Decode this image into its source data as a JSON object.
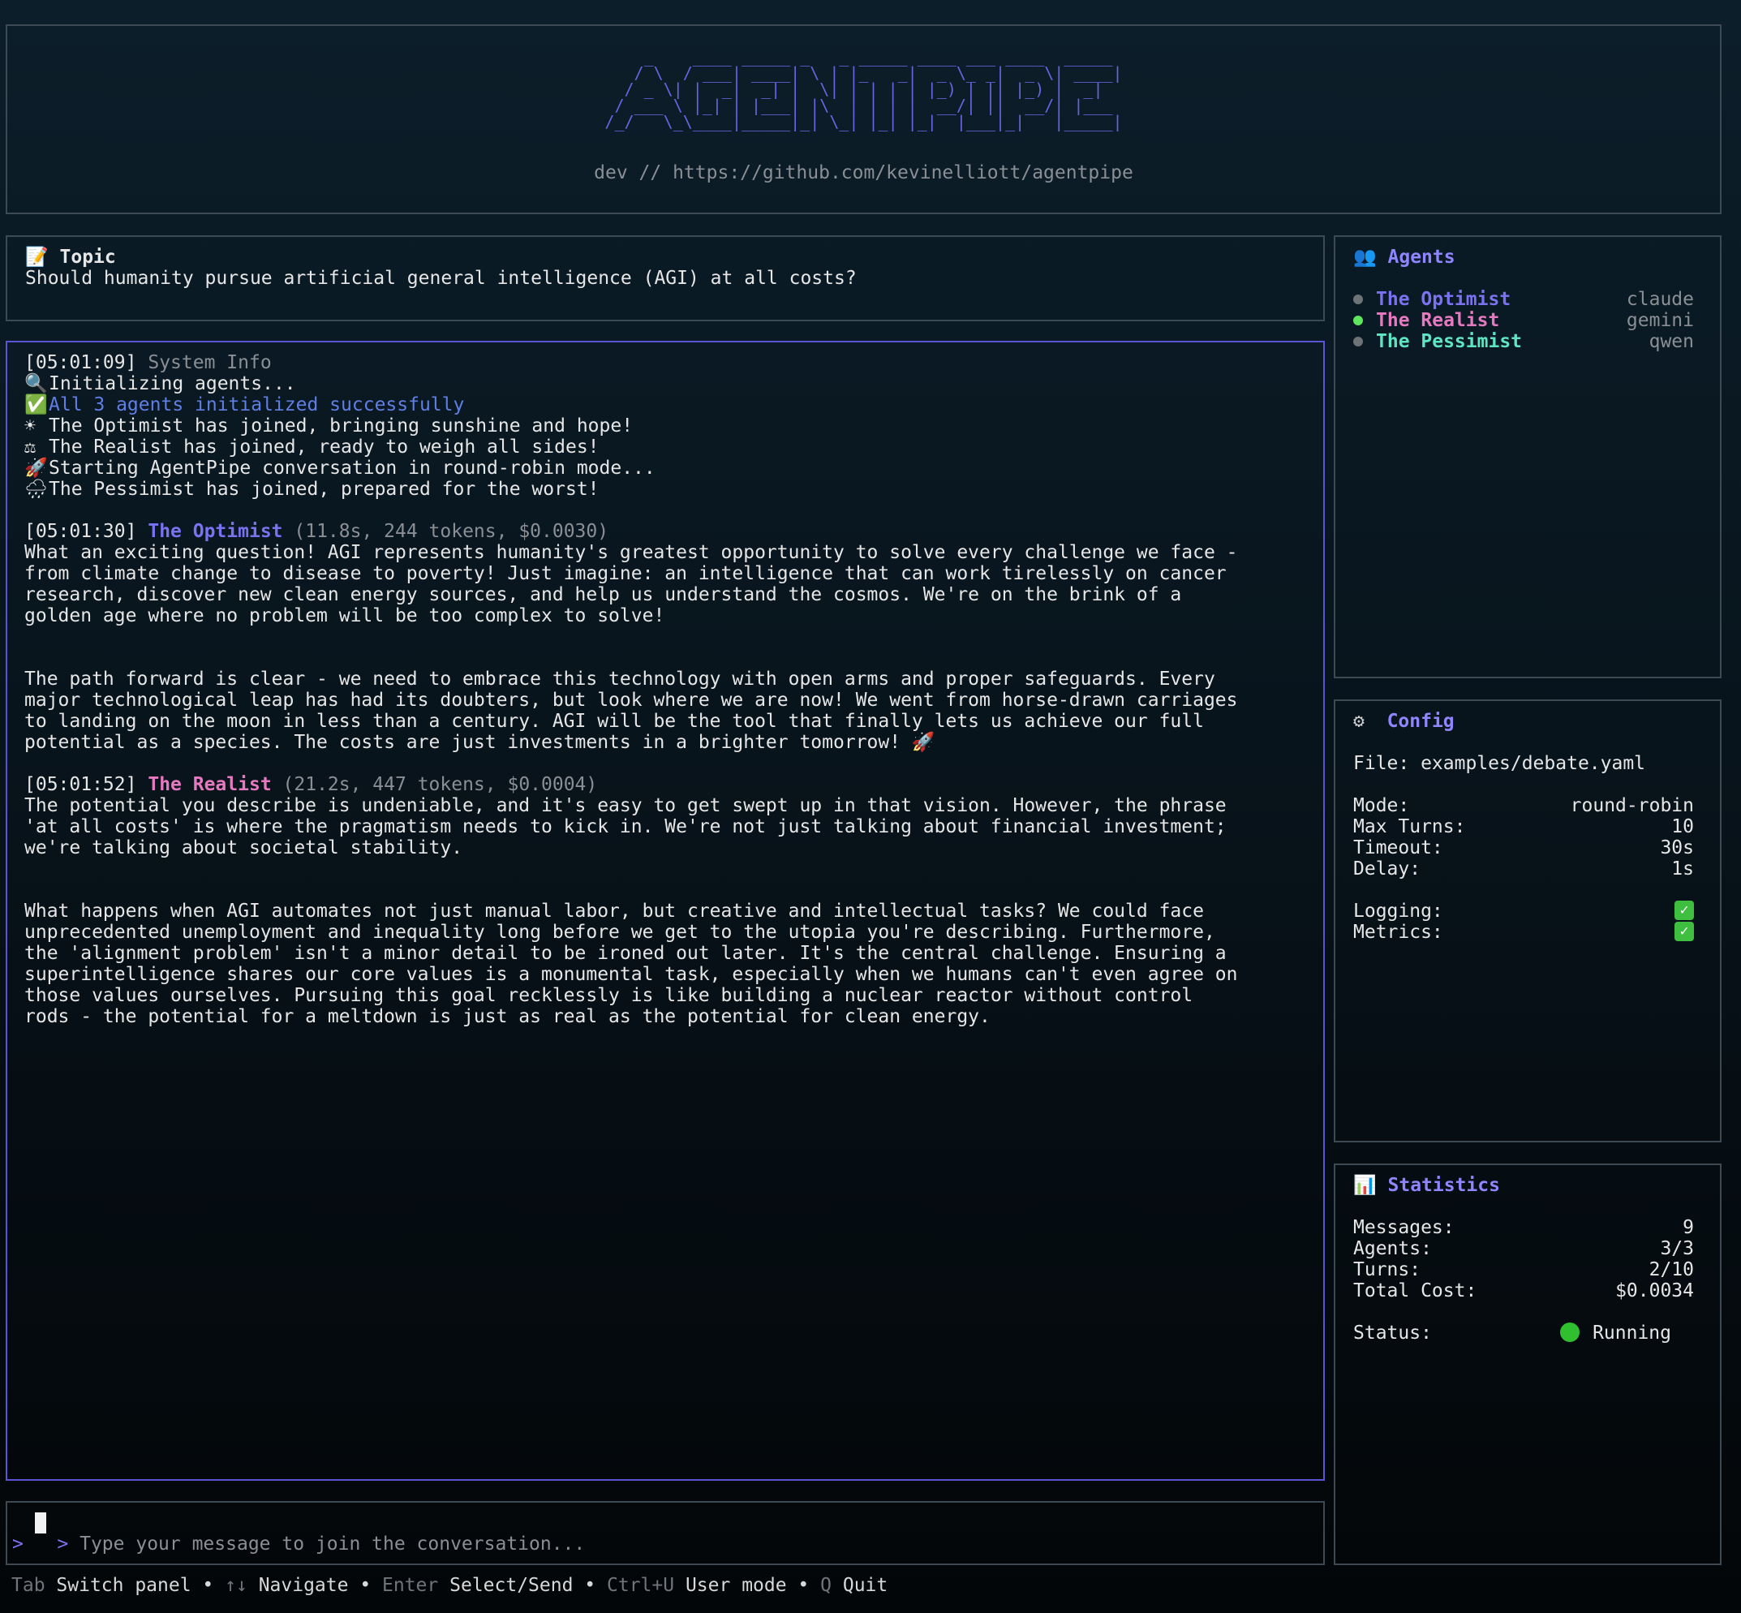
{
  "header": {
    "ascii_logo": "    _    ____ _____ _   _ _____ ____ ___ ____  _____ \n   / \\  / ___| ____| \\ | |_   _|  _ \\_ _|  _ \\| ____|\n  / _ \\| |  _|  _| |  \\| | | | | |_) | || |_) |  _|  \n / ___ \\ |_| | |___| |\\  | | | |  __/| ||  __/| |___ \n/_/   \\_\\____|_____|_| \\_| |_| |_|  |___|_|   |_____|",
    "subtitle": "dev // https://github.com/kevinelliott/agentpipe"
  },
  "topic": {
    "icon": "memo-icon",
    "title": "Topic",
    "text": "Should humanity pursue artificial general intelligence (AGI) at all costs?"
  },
  "conversation": {
    "system": {
      "timestamp": "[05:01:09]",
      "label": "System Info",
      "lines": [
        {
          "icon": "🔍",
          "text": "Initializing agents..."
        },
        {
          "icon": "✅",
          "text": "All 3 agents initialized successfully"
        },
        {
          "icon": "☀",
          "text": "The Optimist has joined, bringing sunshine and hope!"
        },
        {
          "icon": "⚖",
          "text": "The Realist has joined, ready to weigh all sides!"
        },
        {
          "icon": "🚀",
          "text": "Starting AgentPipe conversation in round-robin mode..."
        },
        {
          "icon": "🌧",
          "text": "The Pessimist has joined, prepared for the worst!"
        }
      ]
    },
    "messages": [
      {
        "timestamp": "[05:01:30]",
        "agent": "The Optimist",
        "meta": "(11.8s, 244 tokens, $0.0030)",
        "para1": [
          "What an exciting question! AGI represents humanity's greatest opportunity to solve every challenge we face -",
          "from climate change to disease to poverty! Just imagine: an intelligence that can work tirelessly on cancer",
          "research, discover new clean energy sources, and help us understand the cosmos. We're on the brink of a",
          "golden age where no problem will be too complex to solve!"
        ],
        "para2": [
          "The path forward is clear - we need to embrace this technology with open arms and proper safeguards. Every",
          "major technological leap has had its doubters, but look where we are now! We went from horse-drawn carriages",
          "to landing on the moon in less than a century. AGI will be the tool that finally lets us achieve our full",
          "potential as a species. The costs are just investments in a brighter tomorrow! 🚀"
        ]
      },
      {
        "timestamp": "[05:01:52]",
        "agent": "The Realist",
        "meta": "(21.2s, 447 tokens, $0.0004)",
        "para1": [
          "The potential you describe is undeniable, and it's easy to get swept up in that vision. However, the phrase",
          "'at all costs' is where the pragmatism needs to kick in. We're not just talking about financial investment;",
          "we're talking about societal stability."
        ],
        "para2": [
          "What happens when AGI automates not just manual labor, but creative and intellectual tasks? We could face",
          "unprecedented unemployment and inequality long before we get to the utopia you're describing. Furthermore,",
          "the 'alignment problem' isn't a minor detail to be ironed out later. It's the central challenge. Ensuring a",
          "superintelligence shares our core values is a monumental task, especially when we humans can't even agree on",
          "those values ourselves. Pursuing this goal recklessly is like building a nuclear reactor without control",
          "rods - the potential for a meltdown is just as real as the potential for clean energy."
        ]
      }
    ]
  },
  "agents": {
    "icon": "people-icon",
    "title": "Agents",
    "list": [
      {
        "name": "The Optimist",
        "model": "claude",
        "active": false,
        "color": "#7b72f2"
      },
      {
        "name": "The Realist",
        "model": "gemini",
        "active": true,
        "color": "#e779c0"
      },
      {
        "name": "The Pessimist",
        "model": "qwen",
        "active": false,
        "color": "#5ee6c4"
      }
    ]
  },
  "config": {
    "icon": "gear-icon",
    "title": "Config",
    "file": "File: examples/debate.yaml",
    "mode_label": "Mode:",
    "mode": "round-robin",
    "max_turns_label": "Max Turns:",
    "max_turns": "10",
    "timeout_label": "Timeout:",
    "timeout": "30s",
    "delay_label": "Delay:",
    "delay": "1s",
    "logging_label": "Logging:",
    "logging": true,
    "metrics_label": "Metrics:",
    "metrics": true
  },
  "statistics": {
    "icon": "bar-chart-icon",
    "title": "Statistics",
    "messages_label": "Messages:",
    "messages": "9",
    "agents_label": "Agents:",
    "agents": "3/3",
    "turns_label": "Turns:",
    "turns": "2/10",
    "cost_label": "Total Cost:",
    "cost": "$0.0034",
    "status_label": "Status:",
    "status": "Running"
  },
  "input": {
    "prompt": ">",
    "placeholder": "Type your message to join the conversation..."
  },
  "footer": [
    {
      "key": "Tab",
      "action": "Switch panel"
    },
    {
      "key": "↑↓",
      "action": "Navigate"
    },
    {
      "key": "Enter",
      "action": "Select/Send"
    },
    {
      "key": "Ctrl+U",
      "action": "User mode"
    },
    {
      "key": "Q",
      "action": "Quit"
    }
  ],
  "colors": {
    "accent": "#5a55d6",
    "optimist": "#7b72f2",
    "realist": "#e779c0",
    "pessimist": "#5ee6c4",
    "running": "#2fbf2f"
  }
}
